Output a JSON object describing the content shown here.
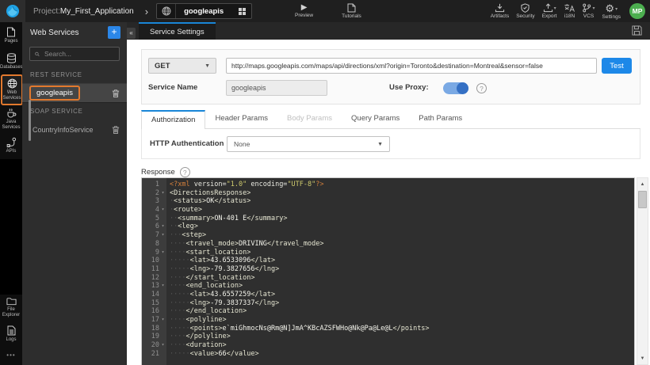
{
  "topbar": {
    "project_label": "Project:",
    "project_name": "My_First_Application",
    "breadcrumb_separator": "›",
    "service_selector": {
      "name": "googleapis"
    },
    "preview_label": "Preview",
    "tutorials_label": "Tutorials",
    "right_items": [
      {
        "label": "Artifacts"
      },
      {
        "label": "Security"
      },
      {
        "label": "Export"
      },
      {
        "label": "i18N"
      },
      {
        "label": "VCS"
      },
      {
        "label": "Settings"
      }
    ],
    "avatar_initials": "MP"
  },
  "sidebar": {
    "items": [
      {
        "label": "Pages"
      },
      {
        "label": "Databases"
      },
      {
        "label": "Web Services",
        "active": true
      },
      {
        "label": "Java Services"
      },
      {
        "label": "APIs"
      }
    ],
    "bottom_items": [
      {
        "label": "File Explorer"
      },
      {
        "label": "Logs"
      }
    ],
    "more_label": "•••"
  },
  "services_panel": {
    "title": "Web Services",
    "add_button_label": "+",
    "collapse_label": "«",
    "search_placeholder": "Search...",
    "rest_section_header": "REST SERVICE",
    "rest_items": [
      {
        "name": "googleapis",
        "highlighted": true
      }
    ],
    "soap_section_header": "SOAP SERVICE",
    "soap_items": [
      {
        "name": "CountryInfoService",
        "highlighted": false
      }
    ]
  },
  "editor_tab": {
    "label": "Service Settings"
  },
  "service_form": {
    "method": "GET",
    "url": "http://maps.googleapis.com/maps/api/directions/xml?origin=Toronto&destination=Montreal&sensor=false",
    "test_button_label": "Test",
    "service_name_label": "Service Name",
    "service_name_value": "googleapis",
    "use_proxy_label": "Use Proxy:",
    "proxy_enabled": true,
    "proxy_help": "?"
  },
  "param_tabs": [
    {
      "label": "Authorization",
      "state": "active"
    },
    {
      "label": "Header Params",
      "state": "normal"
    },
    {
      "label": "Body Params",
      "state": "disabled"
    },
    {
      "label": "Query Params",
      "state": "normal"
    },
    {
      "label": "Path Params",
      "state": "normal"
    }
  ],
  "authorization": {
    "http_auth_label": "HTTP Authentication",
    "http_auth_value": "None"
  },
  "response": {
    "label": "Response",
    "help": "?",
    "lines": [
      {
        "n": 1,
        "fold": false,
        "indent": 0,
        "tokens": [
          {
            "c": "pi",
            "t": "<?xml"
          },
          {
            "c": "plain",
            "t": " version="
          },
          {
            "c": "str",
            "t": "\"1.0\""
          },
          {
            "c": "plain",
            "t": " encoding="
          },
          {
            "c": "str",
            "t": "\"UTF-8\""
          },
          {
            "c": "pi",
            "t": "?>"
          }
        ]
      },
      {
        "n": 2,
        "fold": true,
        "indent": 0,
        "tokens": [
          {
            "c": "tag",
            "t": "<DirectionsResponse>"
          }
        ]
      },
      {
        "n": 3,
        "fold": false,
        "indent": 1,
        "tokens": [
          {
            "c": "tag",
            "t": "<status>"
          },
          {
            "c": "val",
            "t": "OK"
          },
          {
            "c": "tag",
            "t": "</status>"
          }
        ]
      },
      {
        "n": 4,
        "fold": true,
        "indent": 1,
        "tokens": [
          {
            "c": "tag",
            "t": "<route>"
          }
        ]
      },
      {
        "n": 5,
        "fold": false,
        "indent": 2,
        "tokens": [
          {
            "c": "tag",
            "t": "<summary>"
          },
          {
            "c": "val",
            "t": "ON-401 E"
          },
          {
            "c": "tag",
            "t": "</summary>"
          }
        ]
      },
      {
        "n": 6,
        "fold": true,
        "indent": 2,
        "tokens": [
          {
            "c": "tag",
            "t": "<leg>"
          }
        ]
      },
      {
        "n": 7,
        "fold": true,
        "indent": 3,
        "tokens": [
          {
            "c": "tag",
            "t": "<step>"
          }
        ]
      },
      {
        "n": 8,
        "fold": false,
        "indent": 4,
        "tokens": [
          {
            "c": "tag",
            "t": "<travel_mode>"
          },
          {
            "c": "val",
            "t": "DRIVING"
          },
          {
            "c": "tag",
            "t": "</travel_mode>"
          }
        ]
      },
      {
        "n": 9,
        "fold": true,
        "indent": 4,
        "tokens": [
          {
            "c": "tag",
            "t": "<start_location>"
          }
        ]
      },
      {
        "n": 10,
        "fold": false,
        "indent": 5,
        "tokens": [
          {
            "c": "tag",
            "t": "<lat>"
          },
          {
            "c": "val",
            "t": "43.6533096"
          },
          {
            "c": "tag",
            "t": "</lat>"
          }
        ]
      },
      {
        "n": 11,
        "fold": false,
        "indent": 5,
        "tokens": [
          {
            "c": "tag",
            "t": "<lng>"
          },
          {
            "c": "val",
            "t": "-79.3827656"
          },
          {
            "c": "tag",
            "t": "</lng>"
          }
        ]
      },
      {
        "n": 12,
        "fold": false,
        "indent": 4,
        "tokens": [
          {
            "c": "tag",
            "t": "</start_location>"
          }
        ]
      },
      {
        "n": 13,
        "fold": true,
        "indent": 4,
        "tokens": [
          {
            "c": "tag",
            "t": "<end_location>"
          }
        ]
      },
      {
        "n": 14,
        "fold": false,
        "indent": 5,
        "tokens": [
          {
            "c": "tag",
            "t": "<lat>"
          },
          {
            "c": "val",
            "t": "43.6557259"
          },
          {
            "c": "tag",
            "t": "</lat>"
          }
        ]
      },
      {
        "n": 15,
        "fold": false,
        "indent": 5,
        "tokens": [
          {
            "c": "tag",
            "t": "<lng>"
          },
          {
            "c": "val",
            "t": "-79.3837337"
          },
          {
            "c": "tag",
            "t": "</lng>"
          }
        ]
      },
      {
        "n": 16,
        "fold": false,
        "indent": 4,
        "tokens": [
          {
            "c": "tag",
            "t": "</end_location>"
          }
        ]
      },
      {
        "n": 17,
        "fold": true,
        "indent": 4,
        "tokens": [
          {
            "c": "tag",
            "t": "<polyline>"
          }
        ]
      },
      {
        "n": 18,
        "fold": false,
        "indent": 5,
        "tokens": [
          {
            "c": "tag",
            "t": "<points>"
          },
          {
            "c": "val",
            "t": "e`miGhmocNs@Rm@N]JmA^KBcAZSFWHo@Nk@Pa@Le@L"
          },
          {
            "c": "tag",
            "t": "</points>"
          }
        ]
      },
      {
        "n": 19,
        "fold": false,
        "indent": 4,
        "tokens": [
          {
            "c": "tag",
            "t": "</polyline>"
          }
        ]
      },
      {
        "n": 20,
        "fold": true,
        "indent": 4,
        "tokens": [
          {
            "c": "tag",
            "t": "<duration>"
          }
        ]
      },
      {
        "n": 21,
        "fold": false,
        "indent": 5,
        "tokens": [
          {
            "c": "tag",
            "t": "<value>"
          },
          {
            "c": "val",
            "t": "66"
          },
          {
            "c": "tag",
            "t": "</value>"
          }
        ]
      }
    ]
  },
  "colors": {
    "accent_blue": "#1986d7",
    "test_button_blue": "#1d88e8",
    "highlight_orange": "#e2792e",
    "avatar_green": "#4cae4f",
    "toggle_track": "#7aa9e4",
    "toggle_knob": "#3570c4",
    "editor_bg": "#2f2f2f",
    "gutter_bg": "#3c3c3c"
  }
}
